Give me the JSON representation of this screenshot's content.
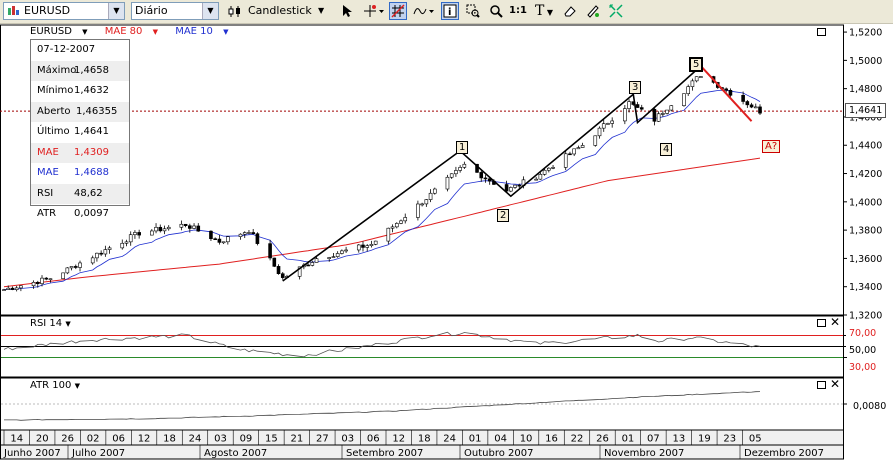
{
  "toolbar": {
    "symbol": "EURUSD",
    "period": "Diário",
    "chart_type": "Candlestick",
    "icons": [
      "cursor-icon",
      "crosshair-icon",
      "grid-icon",
      "indicator-icon",
      "info-icon",
      "zoom-area-icon",
      "zoom-icon",
      "zoom-reset-icon",
      "text-tool-icon",
      "eraser-icon",
      "draw-tool-icon",
      "fit-icon"
    ],
    "zoom_reset_label": "1:1",
    "text_tool_label": "T"
  },
  "legend": {
    "symbol": "EURUSD",
    "mae80": "MAE 80",
    "mae10": "MAE 10"
  },
  "info": {
    "date": "07-12-2007",
    "rows": [
      {
        "label": "Máximo",
        "value": "1,4658"
      },
      {
        "label": "Mínimo",
        "value": "1,4632"
      },
      {
        "label": "Aberto",
        "value": "1,46355"
      },
      {
        "label": "Último",
        "value": "1,4641"
      },
      {
        "label": "MAE",
        "value": "1,4309"
      },
      {
        "label": "MAE",
        "value": "1,4688"
      },
      {
        "label": "RSI",
        "value": "48,62"
      },
      {
        "label": "ATR",
        "value": "0,0097"
      }
    ]
  },
  "colors": {
    "mae80": "#e02020",
    "mae10": "#2030d0",
    "bull": "#ffffff",
    "bear": "#000000",
    "last_price_line": "#a00000"
  },
  "price_axis": {
    "ticks": [
      "1,5200",
      "1,5000",
      "1,4800",
      "1,4600",
      "1,4400",
      "1,4200",
      "1,4000",
      "1,3800",
      "1,3600",
      "1,3400",
      "1,3200"
    ],
    "last_price": "1,4641"
  },
  "waves": {
    "labels": [
      "1",
      "2",
      "3",
      "4",
      "5",
      "A?"
    ]
  },
  "rsi_panel": {
    "title": "RSI 14",
    "levels": [
      "70,00",
      "50,00",
      "30,00"
    ]
  },
  "atr_panel": {
    "title": "ATR 100",
    "tick": "0,0080"
  },
  "date_axis": {
    "days": [
      "14",
      "20",
      "26",
      "02",
      "06",
      "12",
      "18",
      "24",
      "03",
      "09",
      "15",
      "21",
      "27",
      "03",
      "06",
      "12",
      "18",
      "24",
      "01",
      "04",
      "10",
      "16",
      "22",
      "26",
      "01",
      "07",
      "13",
      "19",
      "23",
      "05"
    ],
    "months": [
      "Junho 2007",
      "Julho 2007",
      "Agosto 2007",
      "Setembro 2007",
      "Outubro 2007",
      "Novembro 2007",
      "Dezembro 2007"
    ]
  },
  "chart_data": {
    "type": "candlestick",
    "ylim": [
      1.32,
      1.525
    ],
    "x_start": "2007-06-11",
    "x_end": "2007-12-07",
    "close_knots": [
      [
        "2007-06-11",
        1.338
      ],
      [
        "2007-06-22",
        1.346
      ],
      [
        "2007-07-03",
        1.363
      ],
      [
        "2007-07-13",
        1.378
      ],
      [
        "2007-07-24",
        1.384
      ],
      [
        "2007-08-01",
        1.372
      ],
      [
        "2007-08-08",
        1.38
      ],
      [
        "2007-08-16",
        1.346
      ],
      [
        "2007-08-24",
        1.36
      ],
      [
        "2007-09-06",
        1.37
      ],
      [
        "2007-09-20",
        1.405
      ],
      [
        "2007-09-28",
        1.426
      ],
      [
        "2007-10-08",
        1.408
      ],
      [
        "2007-10-15",
        1.418
      ],
      [
        "2007-10-26",
        1.44
      ],
      [
        "2007-11-06",
        1.47
      ],
      [
        "2007-11-12",
        1.458
      ],
      [
        "2007-11-23",
        1.49
      ],
      [
        "2007-12-07",
        1.4641
      ]
    ],
    "mae80_knots": [
      [
        "2007-06-11",
        1.34
      ],
      [
        "2007-07-01",
        1.347
      ],
      [
        "2007-08-01",
        1.356
      ],
      [
        "2007-09-01",
        1.37
      ],
      [
        "2007-10-01",
        1.392
      ],
      [
        "2007-11-01",
        1.415
      ],
      [
        "2007-12-07",
        1.4309
      ]
    ],
    "rsi_knots": [
      [
        "2007-06-11",
        45
      ],
      [
        "2007-07-01",
        62
      ],
      [
        "2007-07-24",
        70
      ],
      [
        "2007-08-05",
        45
      ],
      [
        "2007-08-20",
        33
      ],
      [
        "2007-09-03",
        48
      ],
      [
        "2007-09-20",
        70
      ],
      [
        "2007-09-28",
        75
      ],
      [
        "2007-10-15",
        55
      ],
      [
        "2007-10-24",
        60
      ],
      [
        "2007-11-08",
        70
      ],
      [
        "2007-11-13",
        60
      ],
      [
        "2007-11-21",
        66
      ],
      [
        "2007-12-07",
        48.62
      ]
    ],
    "atr_knots": [
      [
        "2007-06-11",
        0.0058
      ],
      [
        "2007-07-15",
        0.006
      ],
      [
        "2007-08-10",
        0.0064
      ],
      [
        "2007-09-10",
        0.007
      ],
      [
        "2007-10-10",
        0.008
      ],
      [
        "2007-11-10",
        0.009
      ],
      [
        "2007-12-07",
        0.0097
      ]
    ],
    "wave_points": [
      [
        "2007-08-16",
        1.344
      ],
      [
        "2007-09-27",
        1.436
      ],
      [
        "2007-10-09",
        1.404
      ],
      [
        "2007-11-07",
        1.476
      ],
      [
        "2007-11-08",
        1.456
      ],
      [
        "2007-11-23",
        1.496
      ],
      [
        "2007-12-05",
        1.457
      ]
    ]
  }
}
